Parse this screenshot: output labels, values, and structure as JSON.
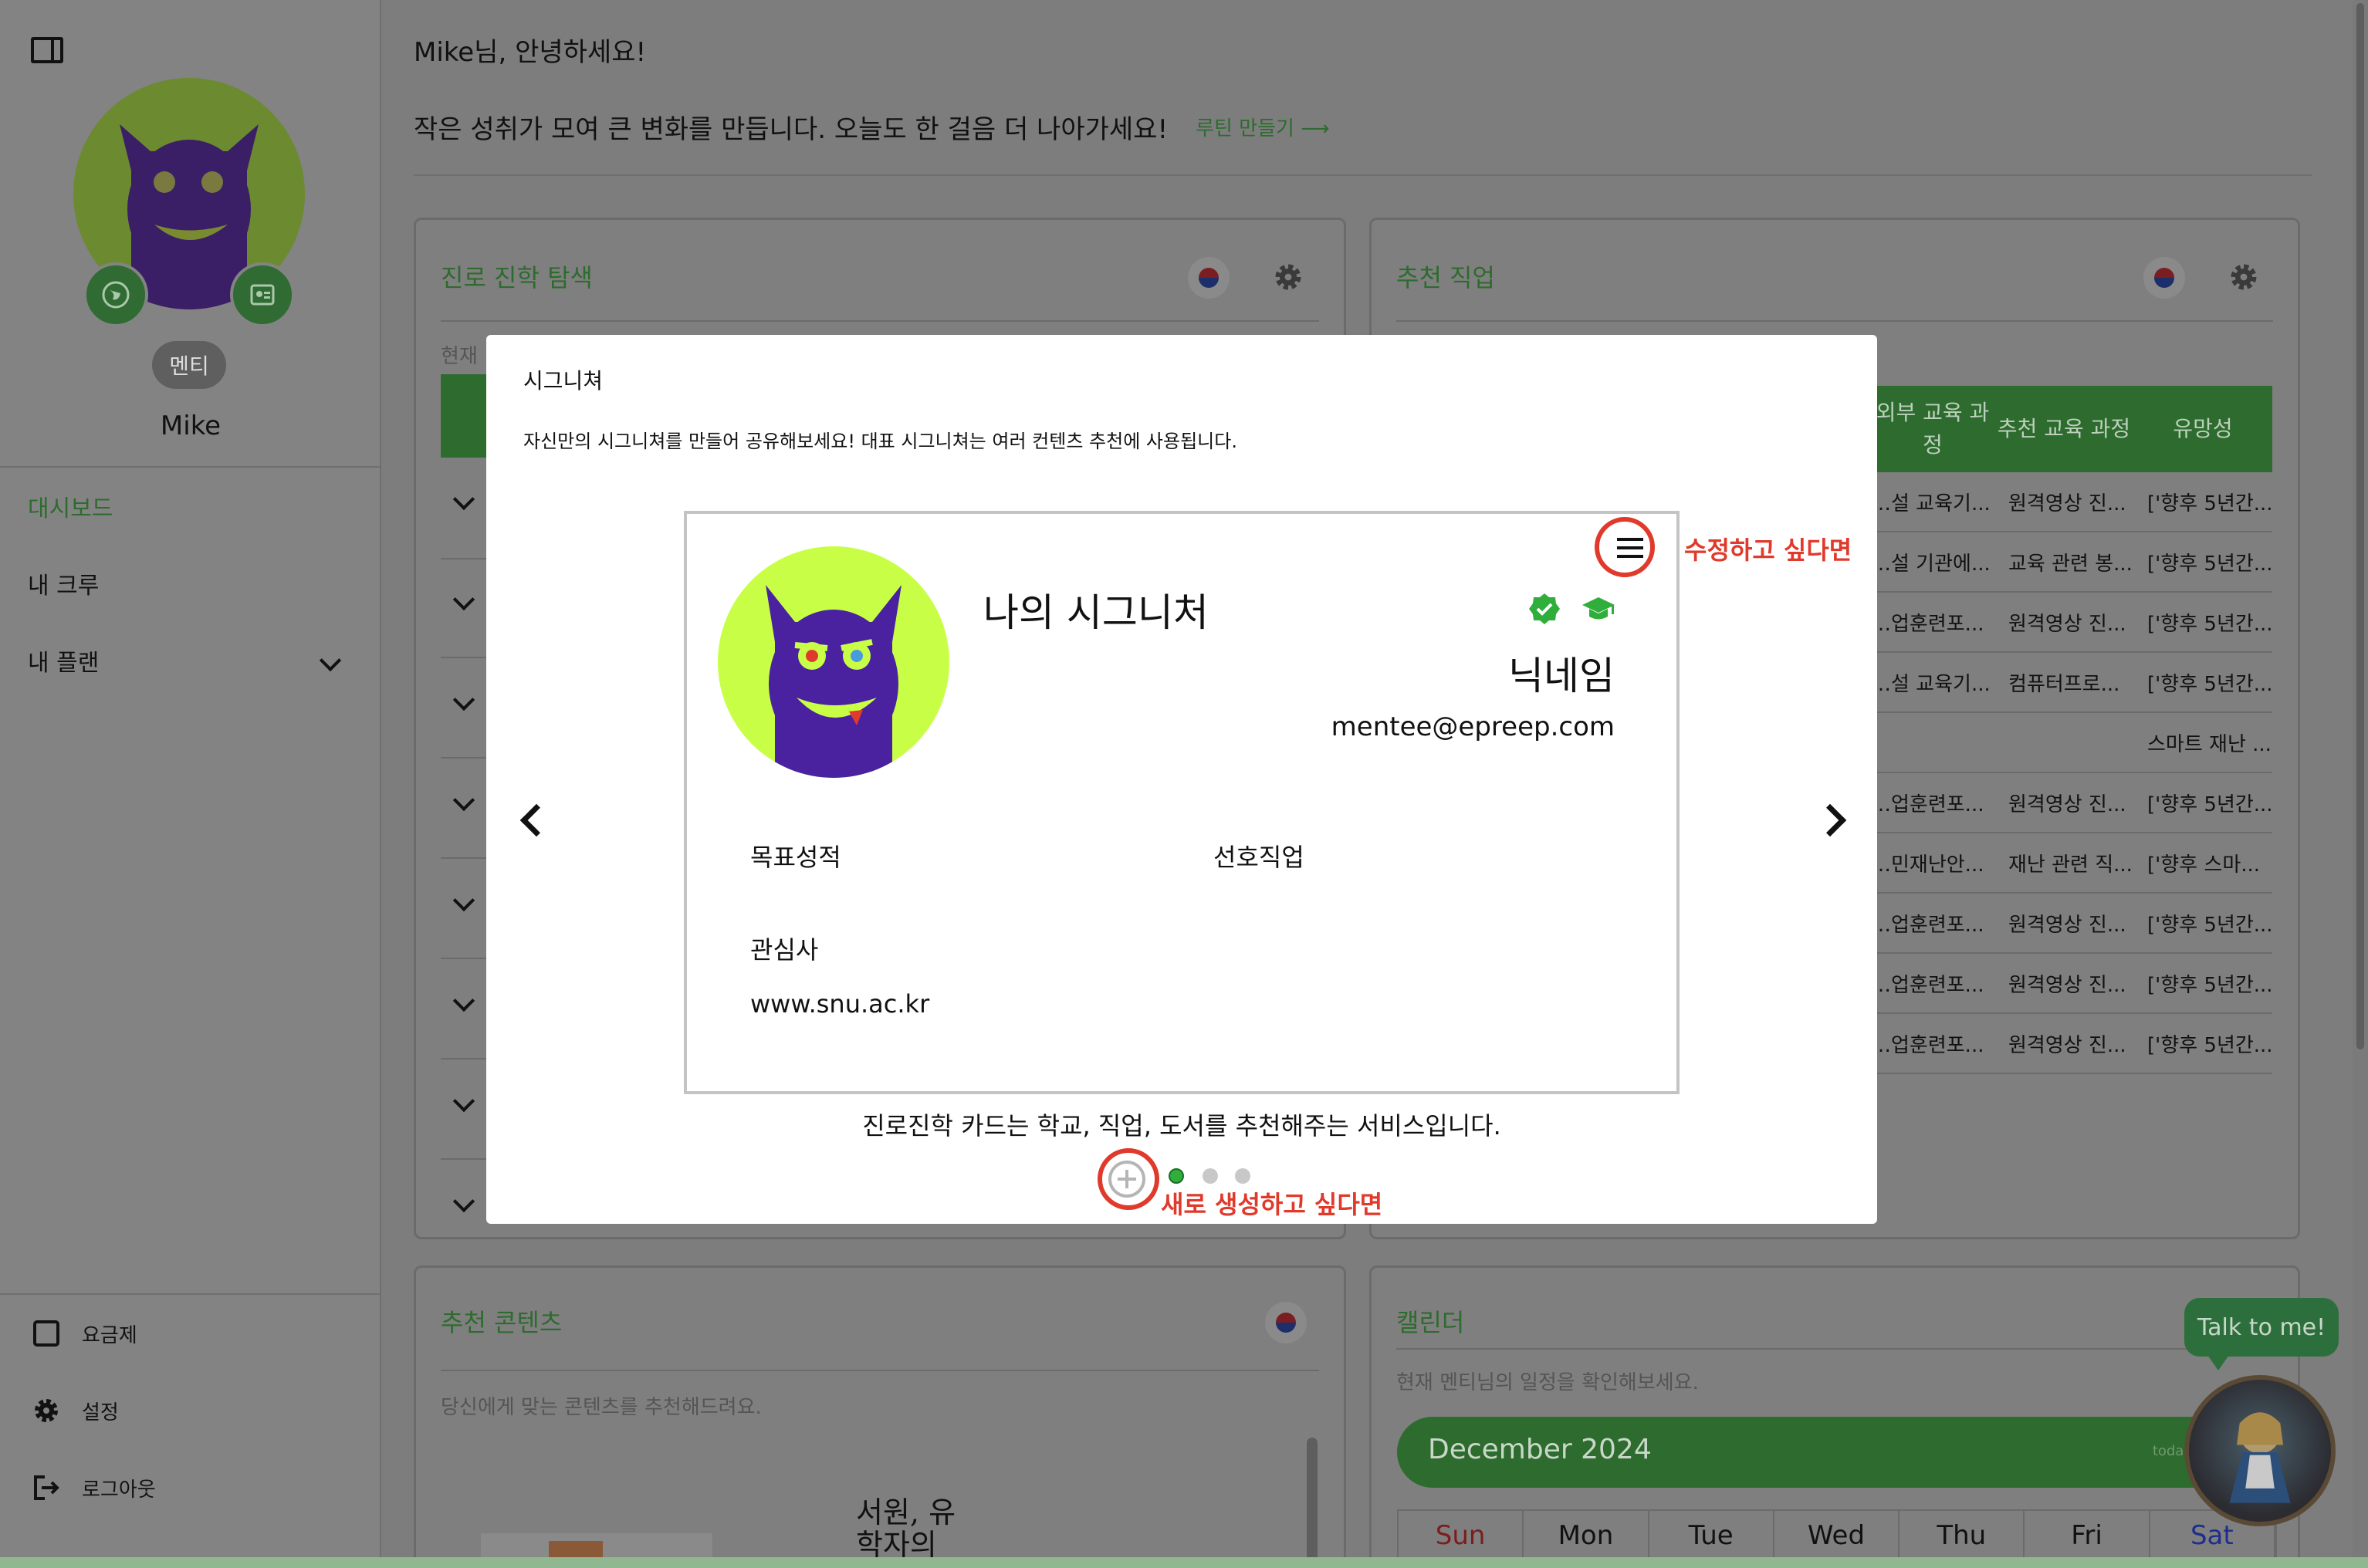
{
  "sidebar": {
    "role_badge": "멘티",
    "user_name": "Mike",
    "nav": [
      {
        "label": "대시보드"
      },
      {
        "label": "내 크루"
      },
      {
        "label": "내 플랜"
      }
    ],
    "bottom": [
      {
        "label": "요금제",
        "icon": "square-icon"
      },
      {
        "label": "설정",
        "icon": "gear-icon"
      },
      {
        "label": "로그아웃",
        "icon": "logout-icon"
      }
    ]
  },
  "header": {
    "greeting": "Mike님, 안녕하세요!",
    "motto": "작은 성취가 모여 큰 변화를 만듭니다. 오늘도 한 걸음 더 나아가세요!",
    "routine_link": "루틴 만들기 ⟶"
  },
  "cards": {
    "career": {
      "title": "진로 진학 탐색",
      "faded_label": "현재"
    },
    "jobs": {
      "title": "추천 직업",
      "headers": [
        "외부 교육 과정",
        "추천 교육 과정",
        "유망성"
      ],
      "rows": [
        [
          "…설 교육기...",
          "원격영상 진...",
          "['향후 5년간..."
        ],
        [
          "…설 기관에...",
          "교육 관련 봉...",
          "['향후 5년간..."
        ],
        [
          "…업훈련포...",
          "원격영상 진...",
          "['향후 5년간..."
        ],
        [
          "…설 교육기...",
          "컴퓨터프로...",
          "['향후 5년간..."
        ],
        [
          "",
          "",
          "스마트 재난 ..."
        ],
        [
          "…업훈련포...",
          "원격영상 진...",
          "['향후 5년간..."
        ],
        [
          "…민재난안...",
          "재난 관련 직...",
          "['향후 스마..."
        ],
        [
          "…업훈련포...",
          "원격영상 진...",
          "['향후 5년간..."
        ],
        [
          "…업훈련포...",
          "원격영상 진...",
          "['향후 5년간..."
        ],
        [
          "…업훈련포...",
          "원격영상 진...",
          "['향후 5년간..."
        ]
      ]
    },
    "contents": {
      "title": "추천 콘텐츠",
      "subtitle": "당신에게 맞는 콘텐츠를 추천해드려요.",
      "book_text": "서원, 유학자의"
    },
    "calendar": {
      "title": "캘린더",
      "subtitle": "현재 멘티님의 일정을 확인해보세요.",
      "month": "December 2024",
      "today": "today",
      "days": [
        "Sun",
        "Mon",
        "Tue",
        "Wed",
        "Thu",
        "Fri",
        "Sat"
      ]
    }
  },
  "chat": {
    "button": "Talk to me!"
  },
  "modal": {
    "title": "시그니쳐",
    "description": "자신만의 시그니쳐를 만들어 공유해보세요! 대표 시그니쳐는 여러 컨텐츠 추천에 사용됩니다.",
    "card": {
      "title": "나의 시그니처",
      "nickname": "닉네임",
      "email": "mentee@epreep.com",
      "goal_label": "목표성적",
      "job_label": "선호직업",
      "interest_label": "관심사",
      "website": "www.snu.ac.kr"
    },
    "edit_note": "수정하고 싶다면",
    "create_note": "새로 생성하고 싶다면",
    "caption": "진로진학 카드는 학교, 직업, 도서를 추천해주는 서비스입니다.",
    "pager": {
      "total": 3,
      "active": 1
    },
    "colors": {
      "accent": "#2fae3c",
      "annotation": "#e03a2c",
      "avatar_bg": "#c8ff46",
      "monster": "#4a22a0"
    }
  }
}
